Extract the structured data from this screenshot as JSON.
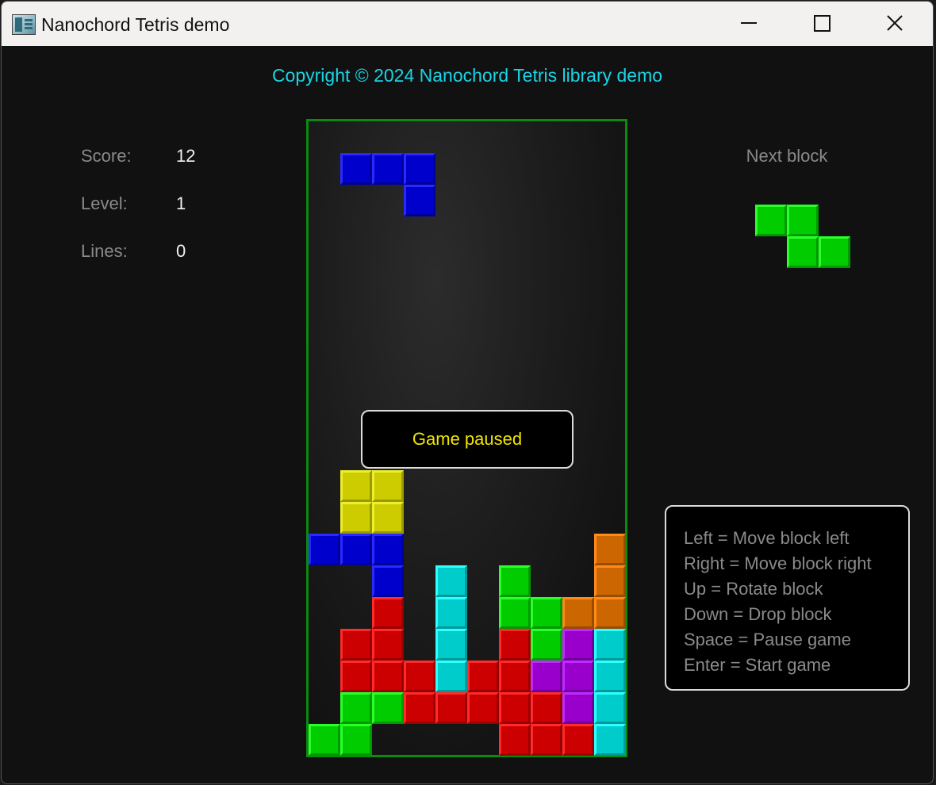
{
  "window": {
    "title": "Nanochord Tetris demo",
    "controls": {
      "minimize_icon": "minimize-icon",
      "maximize_icon": "maximize-icon",
      "close_icon": "close-icon"
    }
  },
  "header": {
    "copyright": "Copyright © 2024 Nanochord Tetris library demo"
  },
  "stats": [
    {
      "label": "Score:",
      "value": "12"
    },
    {
      "label": "Level:",
      "value": "1"
    },
    {
      "label": "Lines:",
      "value": "0"
    }
  ],
  "next_block": {
    "label": "Next block",
    "color": "green",
    "shape": "Z",
    "cells": [
      [
        0,
        0
      ],
      [
        1,
        0
      ],
      [
        1,
        1
      ],
      [
        2,
        1
      ]
    ]
  },
  "board": {
    "columns": 10,
    "rows": 20,
    "falling_piece": {
      "color": "blue",
      "cells": [
        [
          1,
          2
        ],
        [
          2,
          2
        ],
        [
          3,
          2
        ],
        [
          3,
          3
        ]
      ]
    },
    "settled_rows": [
      {
        "row": 11,
        "cells": ""
      },
      {
        "row": 12,
        "cells": ".YY......."
      },
      {
        "row": 13,
        "cells": ".YY......."
      },
      {
        "row": 14,
        "cells": "BBB......O"
      },
      {
        "row": 15,
        "cells": "..B.C.G..O"
      },
      {
        "row": 16,
        "cells": "..R.C.GGOO"
      },
      {
        "row": 17,
        "cells": ".RR.C.RGPC"
      },
      {
        "row": 18,
        "cells": ".RRRCRRPPC"
      },
      {
        "row": 19,
        "cells": ".GGRRRRRPC"
      },
      {
        "row": 20,
        "cells": "GG....RRRC"
      }
    ]
  },
  "colors": {
    "Y": {
      "fill": "#cccc00",
      "light": "#eeee30",
      "dark": "#999900"
    },
    "B": {
      "fill": "#0000cc",
      "light": "#2a2aff",
      "dark": "#000099"
    },
    "R": {
      "fill": "#cc0000",
      "light": "#ff2a2a",
      "dark": "#990000"
    },
    "C": {
      "fill": "#00cccc",
      "light": "#30ffff",
      "dark": "#009999"
    },
    "G": {
      "fill": "#00cc00",
      "light": "#2aff2a",
      "dark": "#009900"
    },
    "O": {
      "fill": "#cc6600",
      "light": "#ff8a1a",
      "dark": "#994c00"
    },
    "P": {
      "fill": "#9900cc",
      "light": "#c02aff",
      "dark": "#6e0099"
    },
    "board_border": "#0b8a10",
    "copyright_text": "#1ad4e6",
    "pause_text": "#f2e600"
  },
  "pause_message": "Game paused",
  "help": [
    "Left = Move block left",
    "Right = Move block right",
    "Up = Rotate block",
    "Down = Drop block",
    "Space = Pause game",
    "Enter = Start game"
  ]
}
